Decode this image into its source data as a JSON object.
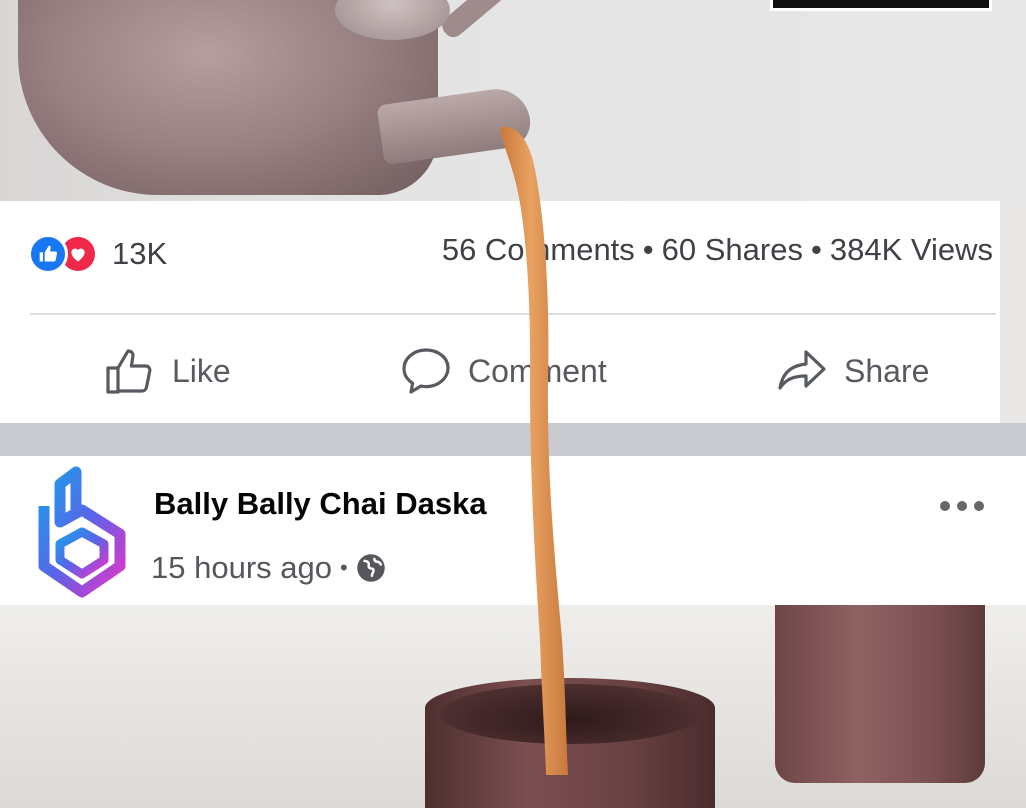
{
  "post_stats": {
    "reaction_count": "13K",
    "comments": "56 Comments",
    "shares": "60 Shares",
    "views": "384K Views",
    "separator": "•"
  },
  "actions": {
    "like_label": "Like",
    "comment_label": "Comment",
    "share_label": "Share"
  },
  "post_header": {
    "page_name": "Bally Bally Chai Daska",
    "timestamp": "15 hours ago",
    "separator": "•",
    "privacy_icon": "globe-icon",
    "more_icon": "more-horizontal-icon"
  },
  "colors": {
    "like_blue": "#1877f2",
    "love_red": "#f0284a",
    "tea_orange": "#d98c4a"
  }
}
